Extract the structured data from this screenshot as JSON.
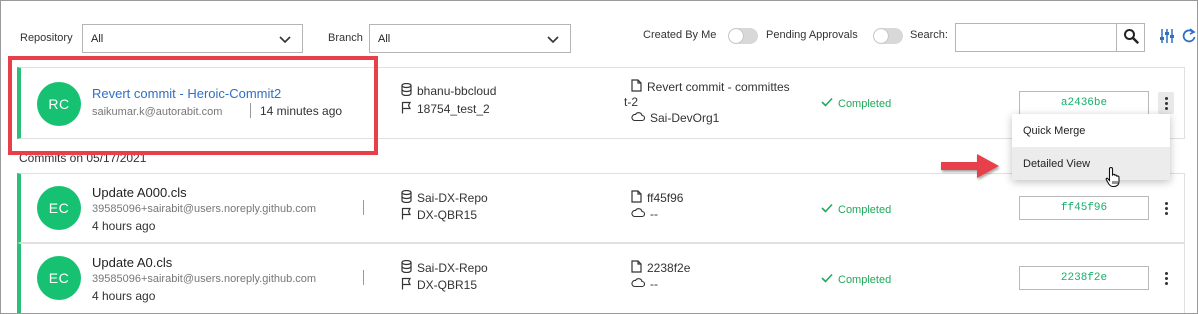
{
  "filters": {
    "repository_label": "Repository",
    "repository_value": "All",
    "branch_label": "Branch",
    "branch_value": "All",
    "created_by_me_label": "Created By Me",
    "pending_approvals_label": "Pending Approvals",
    "search_label": "Search:",
    "search_value": ""
  },
  "commits": [
    {
      "initials": "RC",
      "title": "Revert commit - Heroic-Commit2",
      "email": "saikumar.k@autorabit.com",
      "time": "14 minutes ago",
      "repo": "bhanu-bbcloud",
      "branch": "18754_test_2",
      "commit_ref_line1": "Revert commit - committes",
      "commit_ref_line2": "t-2",
      "org": "Sai-DevOrg1",
      "status": "Completed",
      "hash": "a2436be"
    },
    {
      "initials": "EC",
      "title": "Update A000.cls",
      "email": "39585096+sairabit@users.noreply.github.com",
      "time": "4 hours ago",
      "repo": "Sai-DX-Repo",
      "branch": "DX-QBR15",
      "commit_ref": "ff45f96",
      "org": "--",
      "status": "Completed",
      "hash": "ff45f96"
    },
    {
      "initials": "EC",
      "title": "Update A0.cls",
      "email": "39585096+sairabit@users.noreply.github.com",
      "time": "4 hours ago",
      "repo": "Sai-DX-Repo",
      "branch": "DX-QBR15",
      "commit_ref": "2238f2e",
      "org": "--",
      "status": "Completed",
      "hash": "2238f2e"
    }
  ],
  "date_header": "Commits on 05/17/2021",
  "menu": {
    "quick_merge": "Quick Merge",
    "detailed_view": "Detailed View"
  },
  "colors": {
    "accent_green": "#17c172",
    "status_green": "#20a95a",
    "link_blue": "#2f6fc4",
    "annotation_red": "#e8404b"
  }
}
